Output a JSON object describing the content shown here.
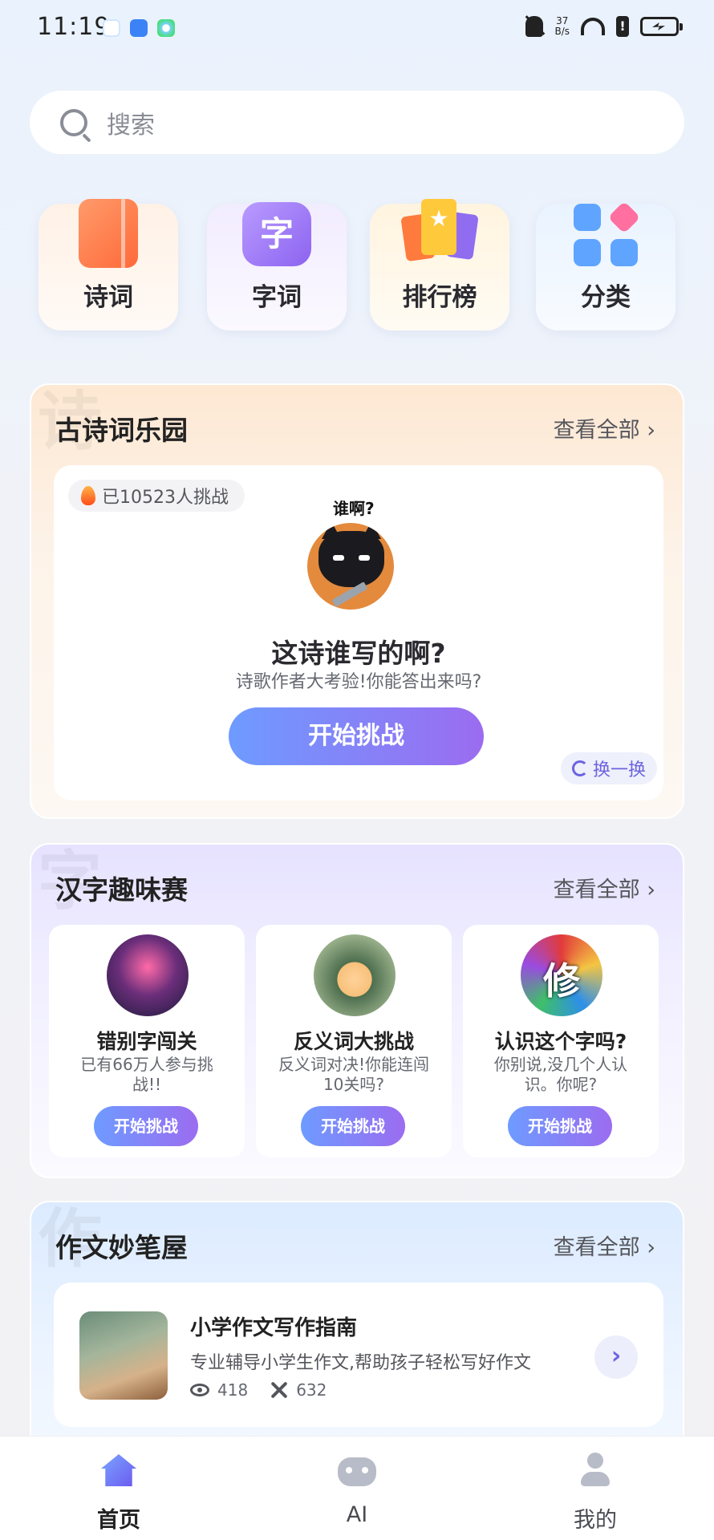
{
  "status_bar": {
    "time": "11:19",
    "net_speed_value": "37",
    "net_speed_unit": "B/s",
    "signal_label": "6"
  },
  "search": {
    "placeholder": "搜索"
  },
  "categories": [
    {
      "label": "诗词",
      "icon": "book-icon"
    },
    {
      "label": "字词",
      "icon": "zi-icon",
      "icon_text": "字"
    },
    {
      "label": "排行榜",
      "icon": "ranking-icon"
    },
    {
      "label": "分类",
      "icon": "grid-icon"
    }
  ],
  "poetry_section": {
    "title": "古诗词乐园",
    "more_label": "查看全部 ›",
    "bg_char": "诗",
    "challenge_count": "已10523人挑战",
    "mascot_bubble": "谁啊?",
    "quiz_title": "这诗谁写的啊?",
    "quiz_subtitle": "诗歌作者大考验!你能答出来吗?",
    "start_label": "开始挑战",
    "refresh_label": "换一换"
  },
  "hanzi_section": {
    "title": "汉字趣味赛",
    "more_label": "查看全部 ›",
    "bg_char": "字",
    "games": [
      {
        "title": "错别字闯关",
        "desc": "已有66万人参与挑战!!",
        "start_label": "开始挑战"
      },
      {
        "title": "反义词大挑战",
        "desc": "反义词对决!你能连闯10关吗?",
        "start_label": "开始挑战"
      },
      {
        "title": "认识这个字吗?",
        "desc": "你别说,没几个人认识。你呢?",
        "start_label": "开始挑战"
      }
    ]
  },
  "essay_section": {
    "title": "作文妙笔屋",
    "more_label": "查看全部 ›",
    "bg_char": "作",
    "article": {
      "title": "小学作文写作指南",
      "desc": "专业辅导小学生作文,帮助孩子轻松写好作文",
      "views": "418",
      "challenges": "632",
      "arrow": "›"
    }
  },
  "tabbar": {
    "items": [
      {
        "label": "首页",
        "icon": "home-icon",
        "active": true
      },
      {
        "label": "AI",
        "icon": "ai-robot-icon",
        "active": false
      },
      {
        "label": "我的",
        "icon": "profile-icon",
        "active": false
      }
    ]
  },
  "colors": {
    "accent_start": "#6e9bff",
    "accent_end": "#9b6cf0",
    "poetry_bg": "#fde8d3",
    "hanzi_bg": "#e6e2ff",
    "essay_bg": "#dcebff"
  }
}
